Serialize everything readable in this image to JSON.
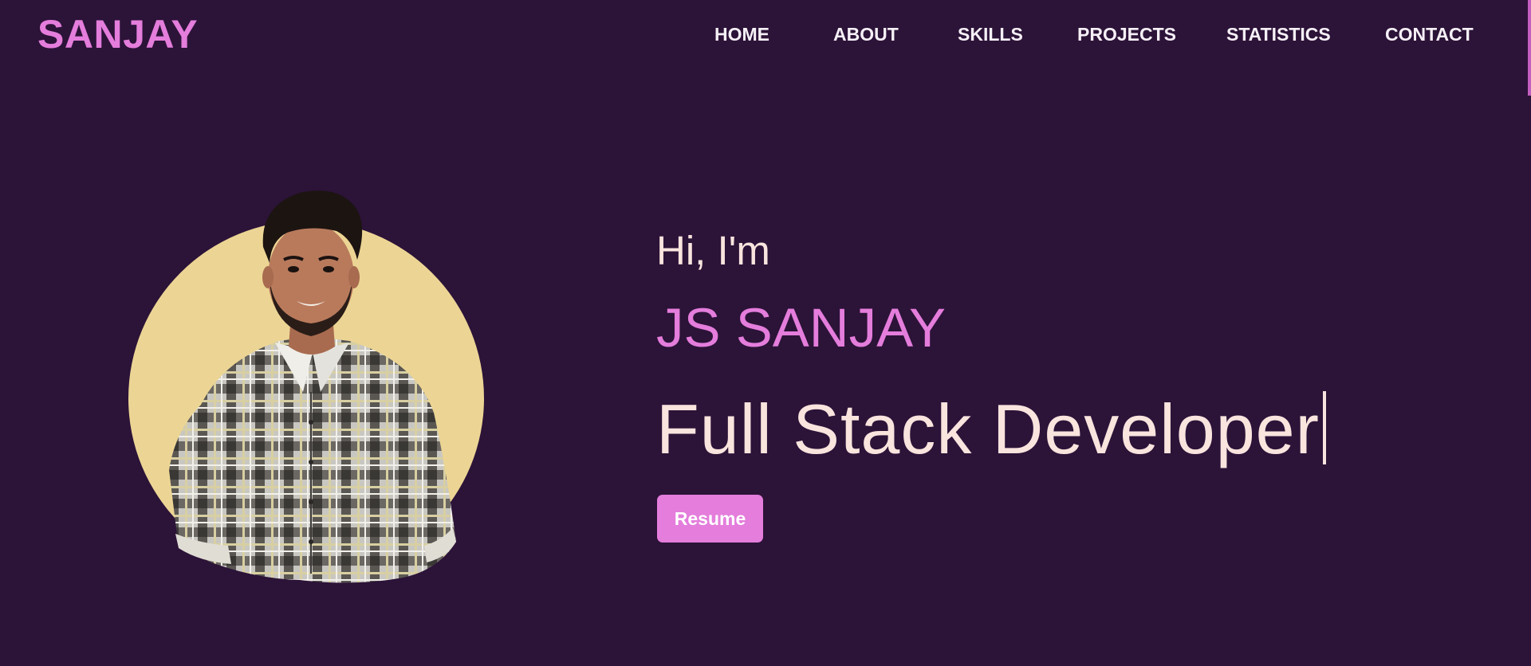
{
  "navbar": {
    "logo": "SANJAY",
    "links": [
      "HOME",
      "ABOUT",
      "SKILLS",
      "PROJECTS",
      "STATISTICS",
      "CONTACT"
    ]
  },
  "hero": {
    "greeting": "Hi, I'm",
    "name": "JS SANJAY",
    "role": "Full Stack Developer",
    "resume_label": "Resume",
    "photo_icon": "person-portrait-icon"
  },
  "colors": {
    "background": "#2c1338",
    "accent": "#e47ddc",
    "text_light": "#f9e4de",
    "photo_circle": "#ecd594"
  }
}
